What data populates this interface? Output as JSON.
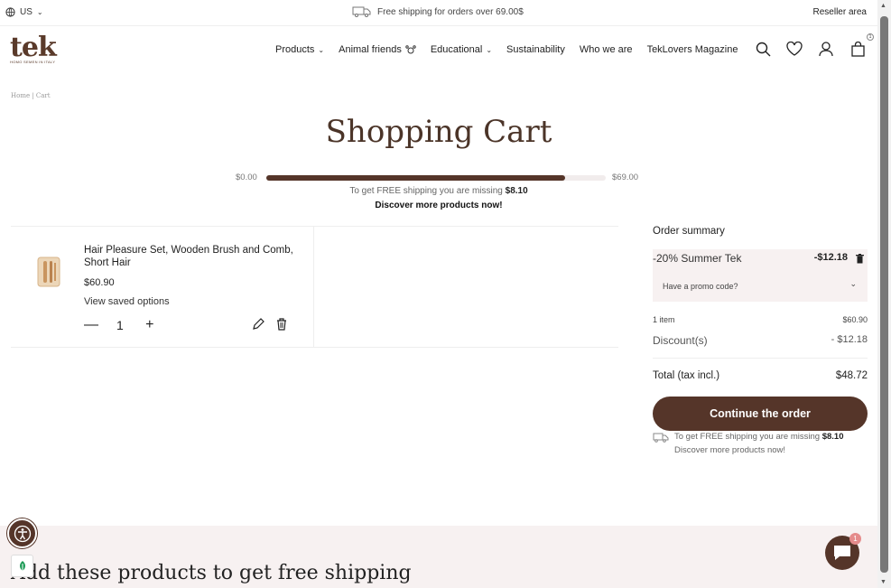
{
  "topbar": {
    "locale": "US",
    "shipping_notice": "Free shipping for orders over 69.00$",
    "reseller": "Reseller area"
  },
  "header": {
    "logo_text": "tek",
    "logo_tagline": "HOMO SEMEN IN ITALY",
    "nav": [
      {
        "label": "Products",
        "dropdown": true
      },
      {
        "label": "Animal friends",
        "dropdown": false
      },
      {
        "label": "Educational",
        "dropdown": true
      },
      {
        "label": "Sustainability",
        "dropdown": false
      },
      {
        "label": "Who we are",
        "dropdown": false
      },
      {
        "label": "TekLovers Magazine",
        "dropdown": false
      }
    ],
    "cart_count": "1"
  },
  "breadcrumb": "Home | Cart",
  "page_title": "Shopping Cart",
  "progress": {
    "min_label": "$0.00",
    "max_label": "$69.00",
    "fill_fraction": 0.88,
    "message": "To get FREE shipping you are missing",
    "missing_amount": "$8.10",
    "link": "Discover more products now!"
  },
  "cart_item": {
    "name": "Hair Pleasure Set, Wooden Brush and Comb, Short Hair",
    "price": "$60.90",
    "saved_options": "View saved options",
    "quantity": "1"
  },
  "summary": {
    "title": "Order summary",
    "promo_name": "-20% Summer Tek",
    "promo_amount": "-$12.18",
    "promo_question": "Have a promo code?",
    "items_label": "1 item",
    "items_value": "$60.90",
    "discount_label": "Discount(s)",
    "discount_value": "- $12.18",
    "total_label": "Total (tax incl.)",
    "total_value": "$48.72",
    "continue_label": "Continue the order",
    "ship_message": "To get FREE shipping you are missing",
    "ship_amount": "$8.10",
    "ship_link": "Discover more products now!"
  },
  "bottom": {
    "heading": "Add these products to get free shipping"
  },
  "chat": {
    "badge": "1"
  },
  "colors": {
    "brand": "#553529",
    "band": "#f7f1f1"
  }
}
